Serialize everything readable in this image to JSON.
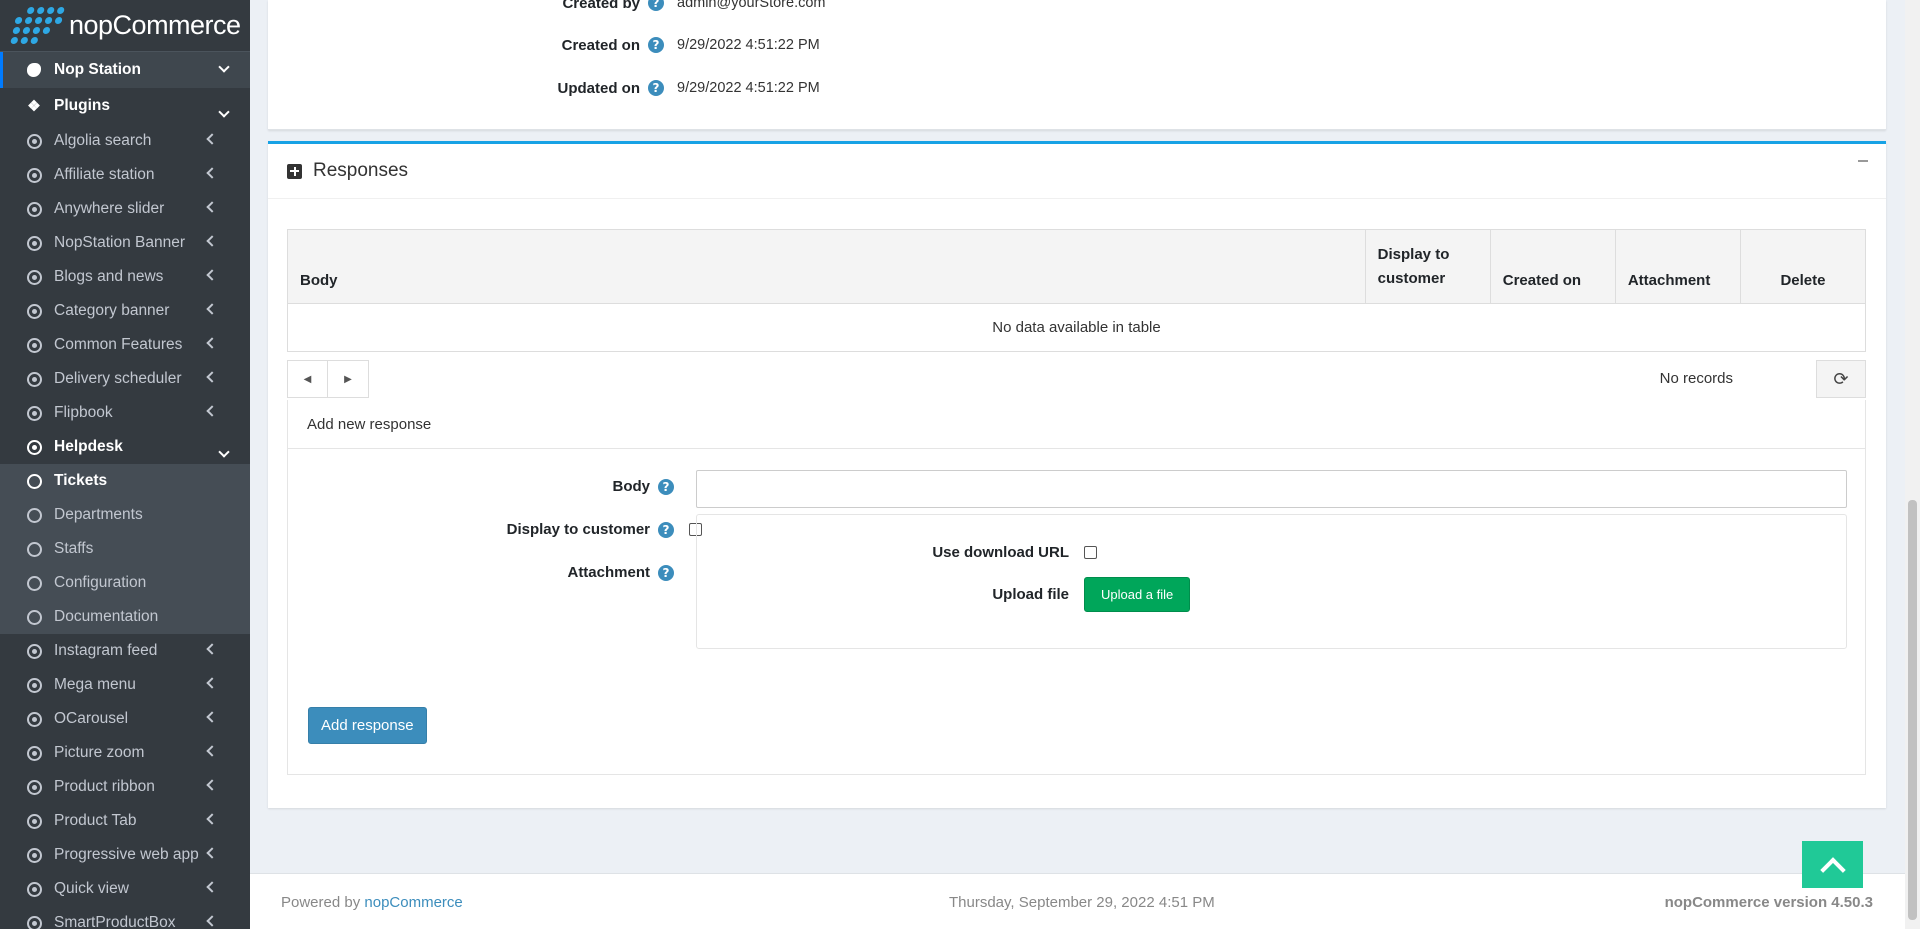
{
  "brand": {
    "name": "nopCommerce"
  },
  "sidebar": {
    "top_item": "Nop Station",
    "plugins_label": "Plugins",
    "items": [
      "Algolia search",
      "Affiliate station",
      "Anywhere slider",
      "NopStation Banner",
      "Blogs and news",
      "Category banner",
      "Common Features",
      "Delivery scheduler",
      "Flipbook"
    ],
    "helpdesk_label": "Helpdesk",
    "helpdesk_items": [
      "Tickets",
      "Departments",
      "Staffs",
      "Configuration",
      "Documentation"
    ],
    "items_after": [
      "Instagram feed",
      "Mega menu",
      "OCarousel",
      "Picture zoom",
      "Product ribbon",
      "Product Tab",
      "Progressive web app",
      "Quick view",
      "SmartProductBox"
    ]
  },
  "ticket_info": {
    "created_by_label": "Created by",
    "created_by_value": "admin@yourStore.com",
    "created_on_label": "Created on",
    "created_on_value": "9/29/2022 4:51:22 PM",
    "updated_on_label": "Updated on",
    "updated_on_value": "9/29/2022 4:51:22 PM"
  },
  "responses": {
    "title": "Responses",
    "columns": {
      "body": "Body",
      "display": "Display to customer",
      "created": "Created on",
      "attachment": "Attachment",
      "delete": "Delete"
    },
    "empty": "No data available in table",
    "no_records": "No records",
    "add_title": "Add new response",
    "body_label": "Body",
    "display_label": "Display to customer",
    "attachment_label": "Attachment",
    "use_download_label": "Use download URL",
    "upload_label": "Upload file",
    "upload_button": "Upload a file",
    "add_button": "Add response"
  },
  "footer": {
    "powered_by": "Powered by",
    "powered_link": "nopCommerce",
    "date": "Thursday, September 29, 2022 4:51 PM",
    "version": "nopCommerce version 4.50.3"
  },
  "colors": {
    "accent": "#3c8dbc",
    "success": "#00a65a",
    "sidebar": "#343a40",
    "card_border": "#17a2e5"
  }
}
